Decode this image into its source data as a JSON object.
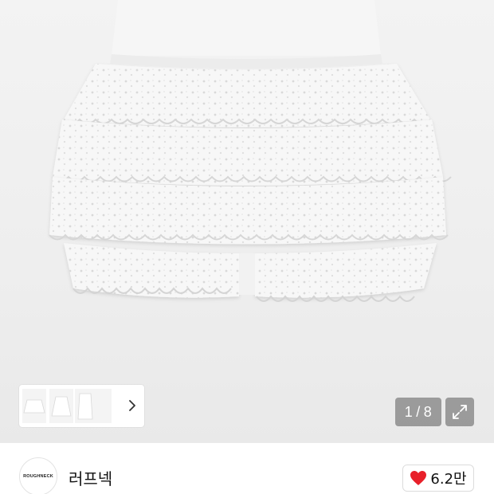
{
  "gallery": {
    "image_description_icon": "white-tiered-lace-skirt-image",
    "thumbnail_count": 3,
    "current_page": "1",
    "separator": "/",
    "total_pages": "8",
    "expand_icon": "expand-icon",
    "next_icon": "chevron-right-icon"
  },
  "brand": {
    "logo_text": "ROUGHNECK",
    "name": "러프넥"
  },
  "like": {
    "icon": "heart-icon",
    "count": "6.2만",
    "heart_color": "#e8202a"
  }
}
